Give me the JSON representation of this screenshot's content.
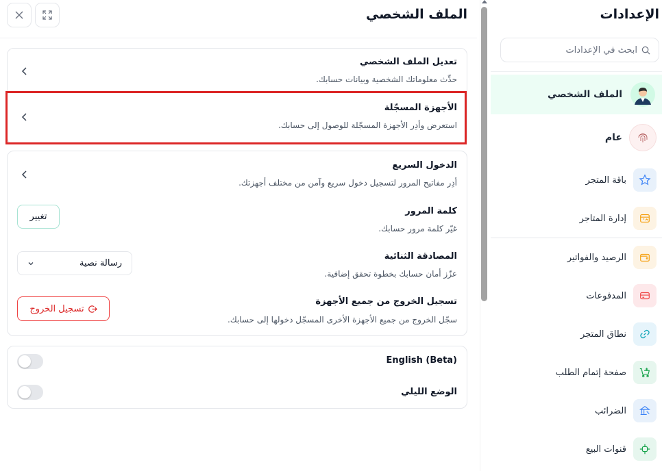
{
  "sidebar": {
    "title": "الإعدادات",
    "search_placeholder": "ابحث في الإعدادات",
    "items": [
      {
        "label": "الملف الشخصي",
        "icon": "user-avatar-icon",
        "active": true
      },
      {
        "label": "عام",
        "icon": "fingerprint-icon"
      },
      {
        "label": "باقة المتجر",
        "icon": "star-icon"
      },
      {
        "label": "إدارة المتاجر",
        "icon": "store-manage-icon"
      },
      {
        "label": "الرصيد والفواتير",
        "icon": "wallet-icon"
      },
      {
        "label": "المدفوعات",
        "icon": "credit-card-icon"
      },
      {
        "label": "نطاق المتجر",
        "icon": "link-icon"
      },
      {
        "label": "صفحة إتمام الطلب",
        "icon": "cart-icon"
      },
      {
        "label": "الضرائب",
        "icon": "tax-building-icon"
      },
      {
        "label": "قنوات البيع",
        "icon": "sales-channels-icon"
      }
    ]
  },
  "main": {
    "title": "الملف الشخصي",
    "profile_edit": {
      "title": "تعديل الملف الشخصي",
      "desc": "حدِّث معلوماتك الشخصية وبيانات حسابك."
    },
    "devices": {
      "title": "الأجهزة المسجّلة",
      "desc": "استعرض وأدِر الأجهزة المسجّلة للوصول إلى حسابك."
    },
    "quick_login": {
      "title": "الدخول السريع",
      "desc": "أدِر مفاتيح المرور لتسجيل دخول سريع وآمن من مختلف أجهزتك."
    },
    "password": {
      "title": "كلمة المرور",
      "desc": "غيّر كلمة مرور حسابك.",
      "button": "تغيير"
    },
    "two_factor": {
      "title": "المصادقة الثنائية",
      "desc": "عزّز أمان حسابك بخطوة تحقق إضافية.",
      "selected": "رسالة نصية"
    },
    "logout_all": {
      "title": "تسجيل الخروج من جميع الأجهزة",
      "desc": "سجّل الخروج من جميع الأجهزة الأخرى المسجّل دخولها إلى حسابك.",
      "button": "تسجيل الخروج"
    },
    "toggles": {
      "english": "English (Beta)",
      "night_mode": "الوضع الليلي"
    }
  },
  "colors": {
    "accent": "#0f9d77",
    "danger": "#dc2626",
    "active_bg": "#ecfdf5"
  }
}
